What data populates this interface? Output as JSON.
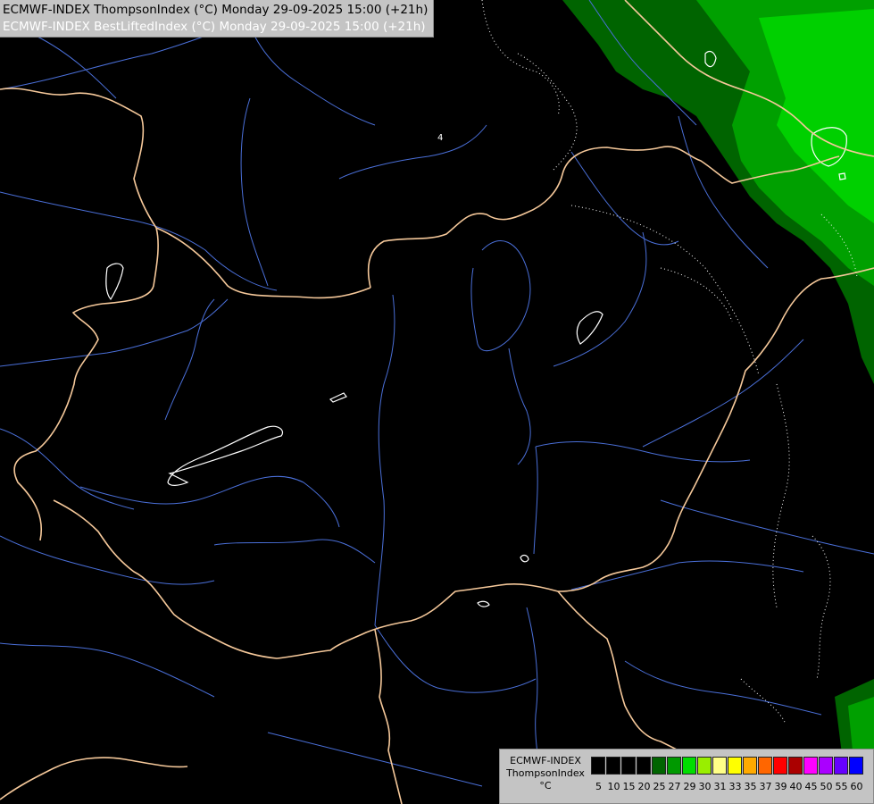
{
  "header": {
    "title_line1": "ECMWF-INDEX ThompsonIndex (°C) Monday 29-09-2025 15:00 (+21h)",
    "title_line2": "ECMWF-INDEX BestLiftedIndex (°C) Monday 29-09-2025 15:00 (+21h)"
  },
  "map": {
    "background": "#000000",
    "border_color": "#f5c89a",
    "river_color": "#4a6fd8",
    "contour_color": "#ffffff",
    "shade_colors": [
      "#006400",
      "#00a000",
      "#00d000"
    ],
    "contour_label": "4"
  },
  "legend": {
    "title_lines": [
      "ECMWF-INDEX",
      "ThompsonIndex",
      "°C"
    ],
    "ticks": [
      "5",
      "10",
      "15",
      "20",
      "25",
      "27",
      "29",
      "30",
      "31",
      "33",
      "35",
      "37",
      "39",
      "40",
      "45",
      "50",
      "55",
      "60"
    ],
    "colors": [
      "#000000",
      "#000000",
      "#000000",
      "#000000",
      "#006400",
      "#009900",
      "#00dd00",
      "#99ee00",
      "#ffff88",
      "#ffff00",
      "#ffaa00",
      "#ff6600",
      "#ff0000",
      "#aa0000",
      "#ff00ff",
      "#aa00ff",
      "#6600ff",
      "#0000ff"
    ]
  }
}
